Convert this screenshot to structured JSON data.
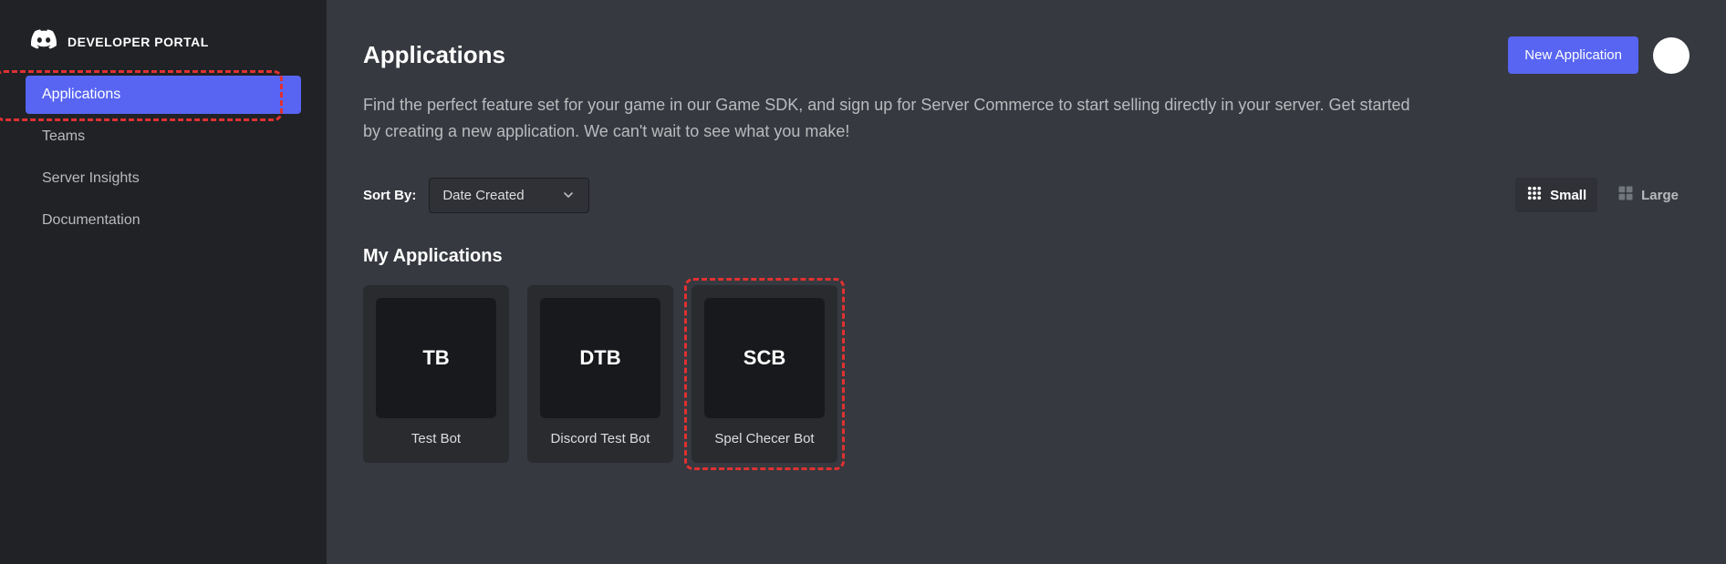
{
  "brand": {
    "text": "DEVELOPER PORTAL"
  },
  "sidebar": {
    "items": [
      {
        "label": "Applications",
        "active": true,
        "highlighted": true
      },
      {
        "label": "Teams",
        "active": false,
        "highlighted": false
      },
      {
        "label": "Server Insights",
        "active": false,
        "highlighted": false
      },
      {
        "label": "Documentation",
        "active": false,
        "highlighted": false
      }
    ]
  },
  "header": {
    "title": "Applications",
    "new_button": "New Application"
  },
  "description": "Find the perfect feature set for your game in our Game SDK, and sign up for Server Commerce to start selling directly in your server. Get started by creating a new application. We can't wait to see what you make!",
  "sort": {
    "label": "Sort By:",
    "value": "Date Created"
  },
  "view": {
    "small": "Small",
    "large": "Large",
    "active": "small"
  },
  "section_title": "My Applications",
  "apps": [
    {
      "initials": "TB",
      "name": "Test Bot",
      "highlighted": false
    },
    {
      "initials": "DTB",
      "name": "Discord Test Bot",
      "highlighted": false
    },
    {
      "initials": "SCB",
      "name": "Spel Checer Bot",
      "highlighted": true
    }
  ]
}
